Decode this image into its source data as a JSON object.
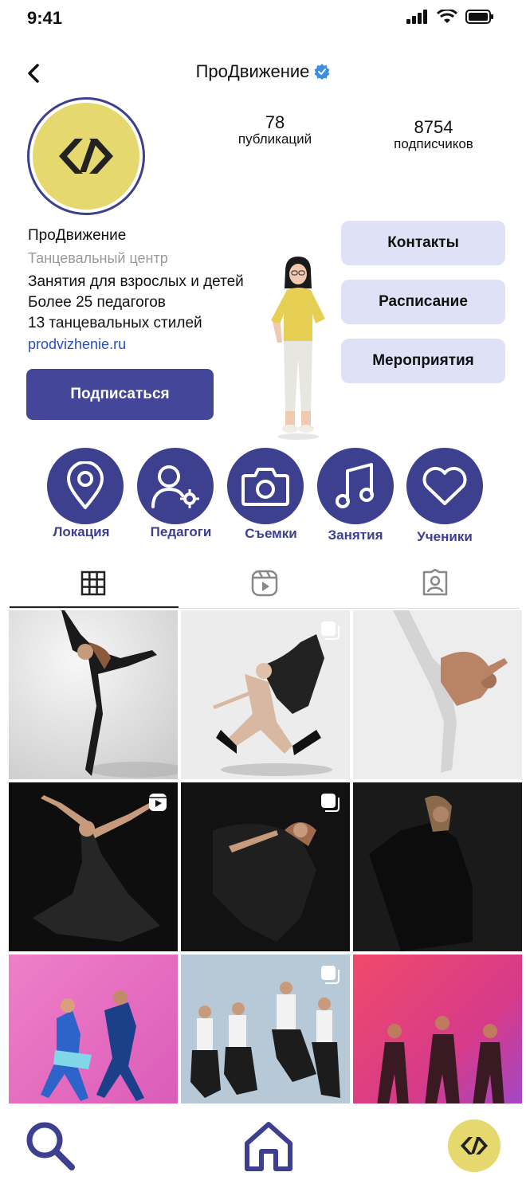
{
  "status_bar": {
    "time": "9:41"
  },
  "header": {
    "title": "ПроДвижение"
  },
  "stats": {
    "posts": {
      "value": "78",
      "label": "публикаций"
    },
    "followers": {
      "value": "8754",
      "label": "подписчиков"
    }
  },
  "bio": {
    "name": "ПроДвижение",
    "category": "Танцевальный центр",
    "lines": [
      "Занятия для взрослых и детей",
      "Более 25 педагогов",
      "13 танцевальных стилей"
    ],
    "link": "prodvizhenie.ru"
  },
  "buttons": {
    "subscribe": "Подписаться",
    "contacts": "Контакты",
    "schedule": "Расписание",
    "events": "Мероприятия"
  },
  "highlights": [
    {
      "label": "Локация",
      "icon": "location-pin-icon"
    },
    {
      "label": "Педагоги",
      "icon": "user-settings-icon"
    },
    {
      "label": "Съемки",
      "icon": "camera-icon"
    },
    {
      "label": "Занятия",
      "icon": "music-note-icon"
    },
    {
      "label": "Ученики",
      "icon": "heart-icon"
    }
  ],
  "tabs": [
    "grid-icon",
    "reels-icon",
    "tagged-icon"
  ],
  "grid": [
    {
      "bg": "light",
      "badge": ""
    },
    {
      "bg": "light",
      "badge": "multi"
    },
    {
      "bg": "light",
      "badge": ""
    },
    {
      "bg": "dark",
      "badge": "reel"
    },
    {
      "bg": "dark",
      "badge": "multi"
    },
    {
      "bg": "dark",
      "badge": ""
    },
    {
      "bg": "pink",
      "badge": ""
    },
    {
      "bg": "blue",
      "badge": "multi"
    },
    {
      "bg": "neon",
      "badge": ""
    }
  ],
  "colors": {
    "accent": "#3d3f8f",
    "button": "#44469a",
    "soft": "#dfe2f6",
    "logo_bg": "#e5d86e",
    "link": "#2d4fb5"
  }
}
